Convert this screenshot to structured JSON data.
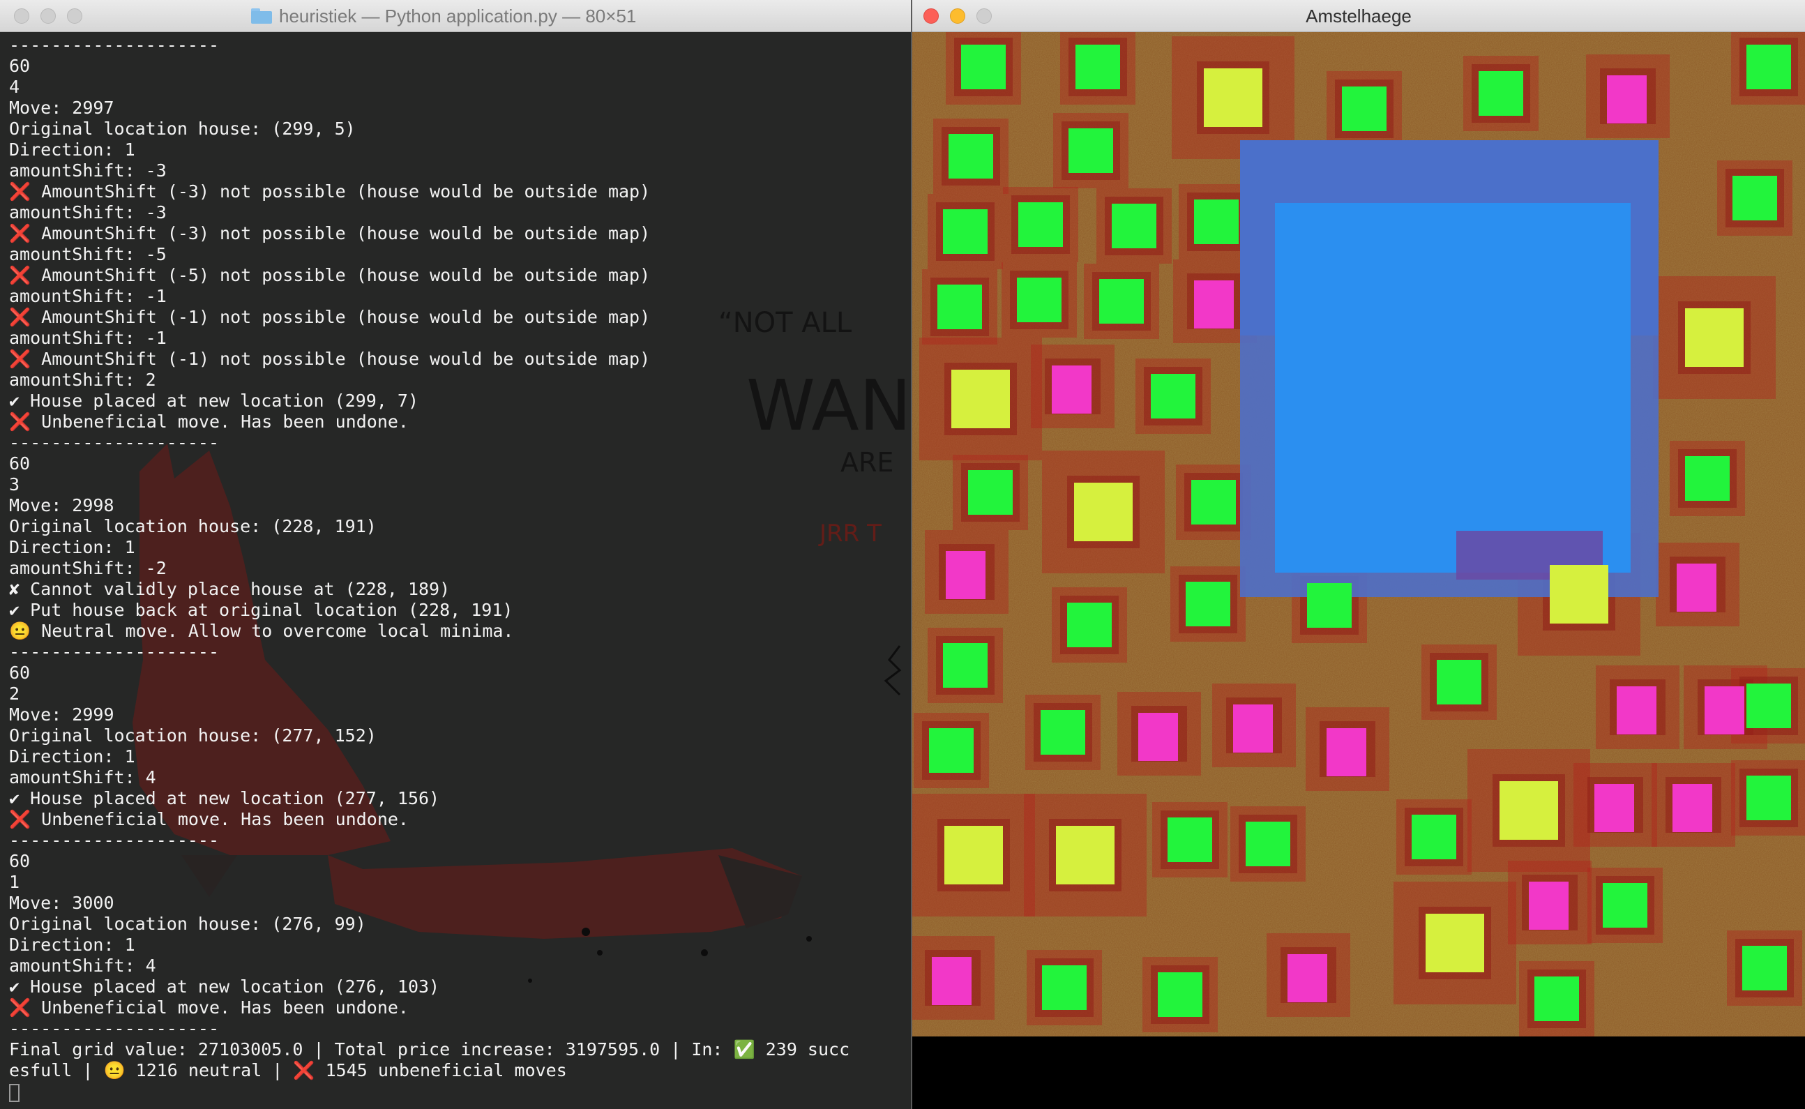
{
  "terminal": {
    "title": "heuristiek — Python application.py — 80×51",
    "wallpaper": {
      "quote_line1": "“NOT ALL",
      "quote_line2": "WAN",
      "quote_line3": "ARE",
      "quote_author": "JRR T"
    },
    "lines": [
      "--------------------",
      "60",
      "4",
      "Move: 2997",
      "Original location house: (299, 5)",
      "Direction: 1",
      "amountShift: -3",
      "❌ AmountShift (-3) not possible (house would be outside map)",
      "amountShift: -3",
      "❌ AmountShift (-3) not possible (house would be outside map)",
      "amountShift: -5",
      "❌ AmountShift (-5) not possible (house would be outside map)",
      "amountShift: -1",
      "❌ AmountShift (-1) not possible (house would be outside map)",
      "amountShift: -1",
      "❌ AmountShift (-1) not possible (house would be outside map)",
      "amountShift: 2",
      "✔ House placed at new location (299, 7)",
      "❌ Unbeneficial move. Has been undone.",
      "--------------------",
      "60",
      "3",
      "Move: 2998",
      "Original location house: (228, 191)",
      "Direction: 1",
      "amountShift: -2",
      "✘ Cannot validly place house at (228, 189)",
      "✔ Put house back at original location (228, 191)",
      "😐 Neutral move. Allow to overcome local minima.",
      "--------------------",
      "60",
      "2",
      "Move: 2999",
      "Original location house: (277, 152)",
      "Direction: 1",
      "amountShift: 4",
      "✔ House placed at new location (277, 156)",
      "❌ Unbeneficial move. Has been undone.",
      "--------------------",
      "60",
      "1",
      "Move: 3000",
      "Original location house: (276, 99)",
      "Direction: 1",
      "amountShift: 4",
      "✔ House placed at new location (276, 103)",
      "❌ Unbeneficial move. Has been undone.",
      "--------------------",
      "Final grid value: 27103005.0 | Total price increase: 3197595.0 | In: ✅ 239 succ",
      "esfull | 😐 1216 neutral | ❌ 1545 unbeneficial moves"
    ]
  },
  "game": {
    "title": "Amstelhaege",
    "colors": {
      "ground": "#8b4a22",
      "water": "#2b8ff0",
      "single_house": "#22f43c",
      "bungalow": "#f238c8",
      "maison": "#d6f03e"
    }
  }
}
